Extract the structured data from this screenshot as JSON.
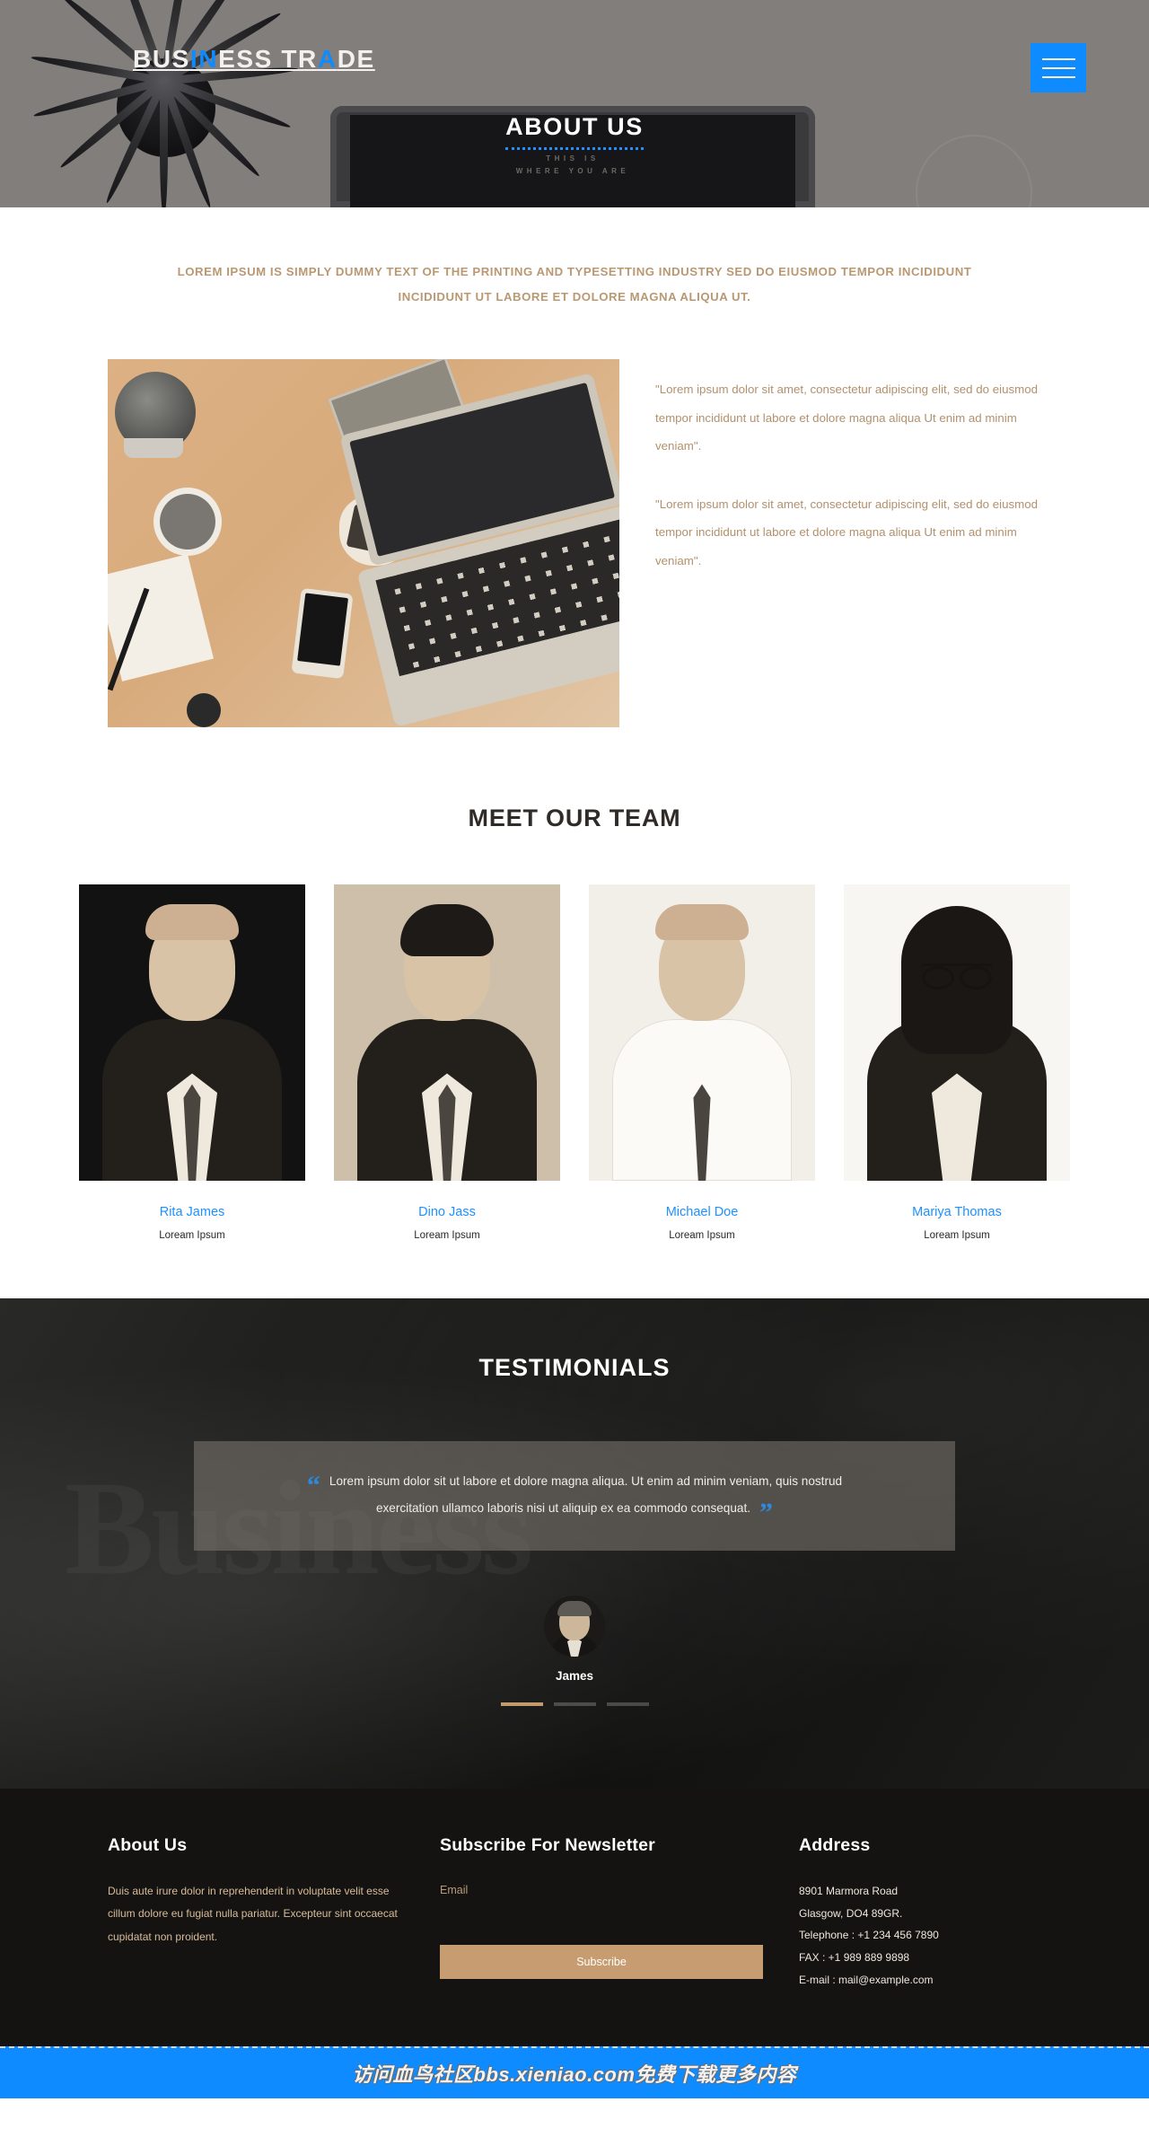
{
  "header": {
    "brand_part1": "BUS",
    "brand_part2": "IN",
    "brand_part3": "ESS TR",
    "brand_part4": "A",
    "brand_part5": "DE",
    "brand_full": "BUSINESS TRADE",
    "menu_label": "menu",
    "page_title": "ABOUT US",
    "screen_line1": "THIS IS",
    "screen_line2": "WHERE YOU ARE",
    "accent_color": "#0d8bff"
  },
  "about": {
    "heading_line1": "LOREM IPSUM IS SIMPLY DUMMY TEXT OF THE PRINTING AND TYPESETTING INDUSTRY SED DO EIUSMOD TEMPOR INCIDIDUNT",
    "heading_line2": "INCIDIDUNT UT LABORE ET DOLORE MAGNA ALIQUA UT.",
    "heading_color": "#b99872",
    "image_alt": "desk-workspace-photo",
    "paragraphs": [
      "\"Lorem ipsum dolor sit amet, consectetur adipiscing elit, sed do eiusmod tempor incididunt ut labore et dolore magna aliqua Ut enim ad minim veniam\".",
      "\"Lorem ipsum dolor sit amet, consectetur adipiscing elit, sed do eiusmod tempor incididunt ut labore et dolore magna aliqua Ut enim ad minim veniam\"."
    ]
  },
  "team": {
    "title": "MEET OUR TEAM",
    "name_color": "#1e90ff",
    "members": [
      {
        "name": "Rita James",
        "role": "Loream Ipsum"
      },
      {
        "name": "Dino Jass",
        "role": "Loream Ipsum"
      },
      {
        "name": "Michael Doe",
        "role": "Loream Ipsum"
      },
      {
        "name": "Mariya Thomas",
        "role": "Loream Ipsum"
      }
    ]
  },
  "testimonials": {
    "title": "TESTIMONIALS",
    "background_word": "Business",
    "quote_open": "“",
    "quote_close": "”",
    "quote_color": "#2b8ae0",
    "quote_line1": "Lorem ipsum dolor sit ut labore et dolore magna aliqua. Ut enim ad minim veniam, quis nostrud",
    "quote_line2": "exercitation ullamco laboris nisi ut aliquip ex ea commodo consequat.",
    "author": "James",
    "active_slide": 1,
    "slide_count": 3,
    "indicator_active_color": "#c49a6c"
  },
  "footer": {
    "about": {
      "title": "About Us",
      "text": "Duis aute irure dolor in reprehenderit in voluptate velit esse cillum dolore eu fugiat nulla pariatur. Excepteur sint occaecat cupidatat non proident."
    },
    "newsletter": {
      "title": "Subscribe For Newsletter",
      "email_value": "",
      "email_placeholder": "Email",
      "button_label": "Subscribe",
      "button_color": "#c79c70"
    },
    "address": {
      "title": "Address",
      "lines": [
        "8901 Marmora Road",
        "Glasgow, DO4 89GR.",
        "Telephone : +1 234 456 7890",
        "FAX : +1 989 889 9898",
        "E-mail : mail@example.com"
      ]
    }
  },
  "watermark": {
    "text": "访问血鸟社区bbs.xieniao.com免费下载更多内容",
    "background_color": "#0d8bff"
  }
}
